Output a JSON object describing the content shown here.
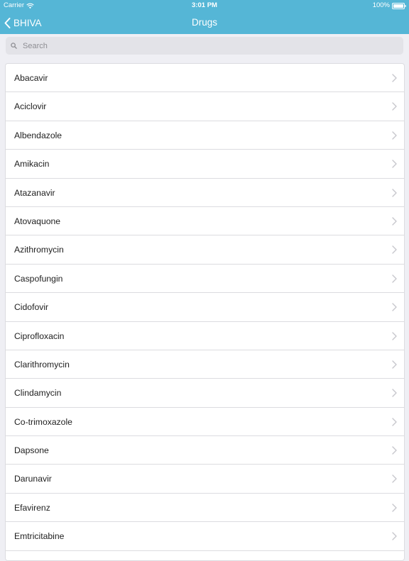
{
  "status_bar": {
    "carrier": "Carrier",
    "time": "3:01 PM",
    "battery": "100%"
  },
  "nav": {
    "back_label": "BHIVA",
    "title": "Drugs"
  },
  "search": {
    "placeholder": "Search"
  },
  "drugs": {
    "items": [
      {
        "label": "Abacavir"
      },
      {
        "label": "Aciclovir"
      },
      {
        "label": "Albendazole"
      },
      {
        "label": "Amikacin"
      },
      {
        "label": "Atazanavir"
      },
      {
        "label": "Atovaquone"
      },
      {
        "label": "Azithromycin"
      },
      {
        "label": "Caspofungin"
      },
      {
        "label": "Cidofovir"
      },
      {
        "label": "Ciprofloxacin"
      },
      {
        "label": "Clarithromycin"
      },
      {
        "label": "Clindamycin"
      },
      {
        "label": "Co-trimoxazole"
      },
      {
        "label": "Dapsone"
      },
      {
        "label": "Darunavir"
      },
      {
        "label": "Efavirenz"
      },
      {
        "label": "Emtricitabine"
      }
    ]
  },
  "colors": {
    "nav_bar": "#55b6d6",
    "background": "#efeff4",
    "search_field": "#e3e3e8",
    "text": "#1e1e1e",
    "chevron": "#c7c7cc"
  }
}
